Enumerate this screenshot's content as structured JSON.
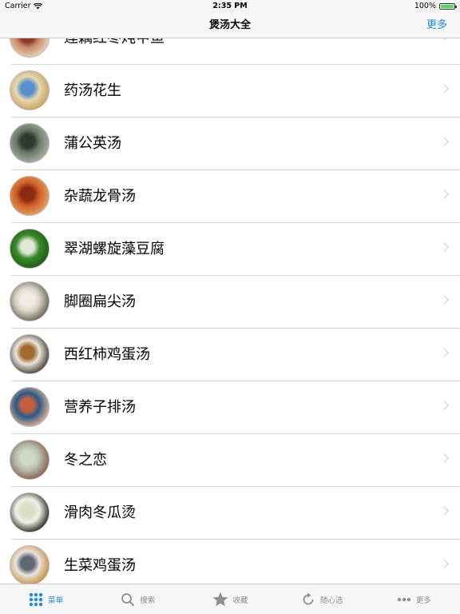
{
  "status_bar": {
    "carrier": "Carrier",
    "time": "2:35 PM",
    "battery": "100%"
  },
  "nav": {
    "title": "煲汤大全",
    "more": "更多"
  },
  "list": {
    "items": [
      {
        "title": "莲藕红枣炖甲鱼",
        "thumb_colors": [
          "#c98a6a",
          "#8a3a2a",
          "#e6d2b8"
        ]
      },
      {
        "title": "药汤花生",
        "thumb_colors": [
          "#e6d8b0",
          "#5b8fc9",
          "#c9a060"
        ]
      },
      {
        "title": "蒲公英汤",
        "thumb_colors": [
          "#6b7a6a",
          "#2e3a30",
          "#a8b0a0"
        ]
      },
      {
        "title": "杂蔬龙骨汤",
        "thumb_colors": [
          "#d0602a",
          "#8a2a10",
          "#e8a060"
        ]
      },
      {
        "title": "翠湖螺旋藻豆腐",
        "thumb_colors": [
          "#3a8a2a",
          "#e0e8d8",
          "#1e5a14"
        ]
      },
      {
        "title": "脚圈扁尖汤",
        "thumb_colors": [
          "#d8d4c8",
          "#f0ece4",
          "#6a6458"
        ]
      },
      {
        "title": "西红柿鸡蛋汤",
        "thumb_colors": [
          "#e8e4dc",
          "#a06a30",
          "#4a4038"
        ]
      },
      {
        "title": "营养子排汤",
        "thumb_colors": [
          "#2a5a8a",
          "#c06040",
          "#e0b090"
        ]
      },
      {
        "title": "冬之恋",
        "thumb_colors": [
          "#b8c0b0",
          "#d0d8c8",
          "#8a6050"
        ]
      },
      {
        "title": "滑肉冬瓜烫",
        "thumb_colors": [
          "#f0f0e8",
          "#d8e0c8",
          "#2a2a20"
        ]
      },
      {
        "title": "生菜鸡蛋汤",
        "thumb_colors": [
          "#e8e4e0",
          "#606870",
          "#c89040"
        ]
      }
    ]
  },
  "tab_bar": {
    "tabs": [
      {
        "label": "菜单",
        "icon": "grid-icon",
        "active": true
      },
      {
        "label": "搜索",
        "icon": "search-icon",
        "active": false
      },
      {
        "label": "收藏",
        "icon": "star-icon",
        "active": false
      },
      {
        "label": "随心选",
        "icon": "refresh-icon",
        "active": false
      },
      {
        "label": "更多",
        "icon": "more-icon",
        "active": false
      }
    ]
  },
  "colors": {
    "accent": "#1e88e5",
    "inactive": "#8e8e93",
    "battery": "#4cd964"
  }
}
